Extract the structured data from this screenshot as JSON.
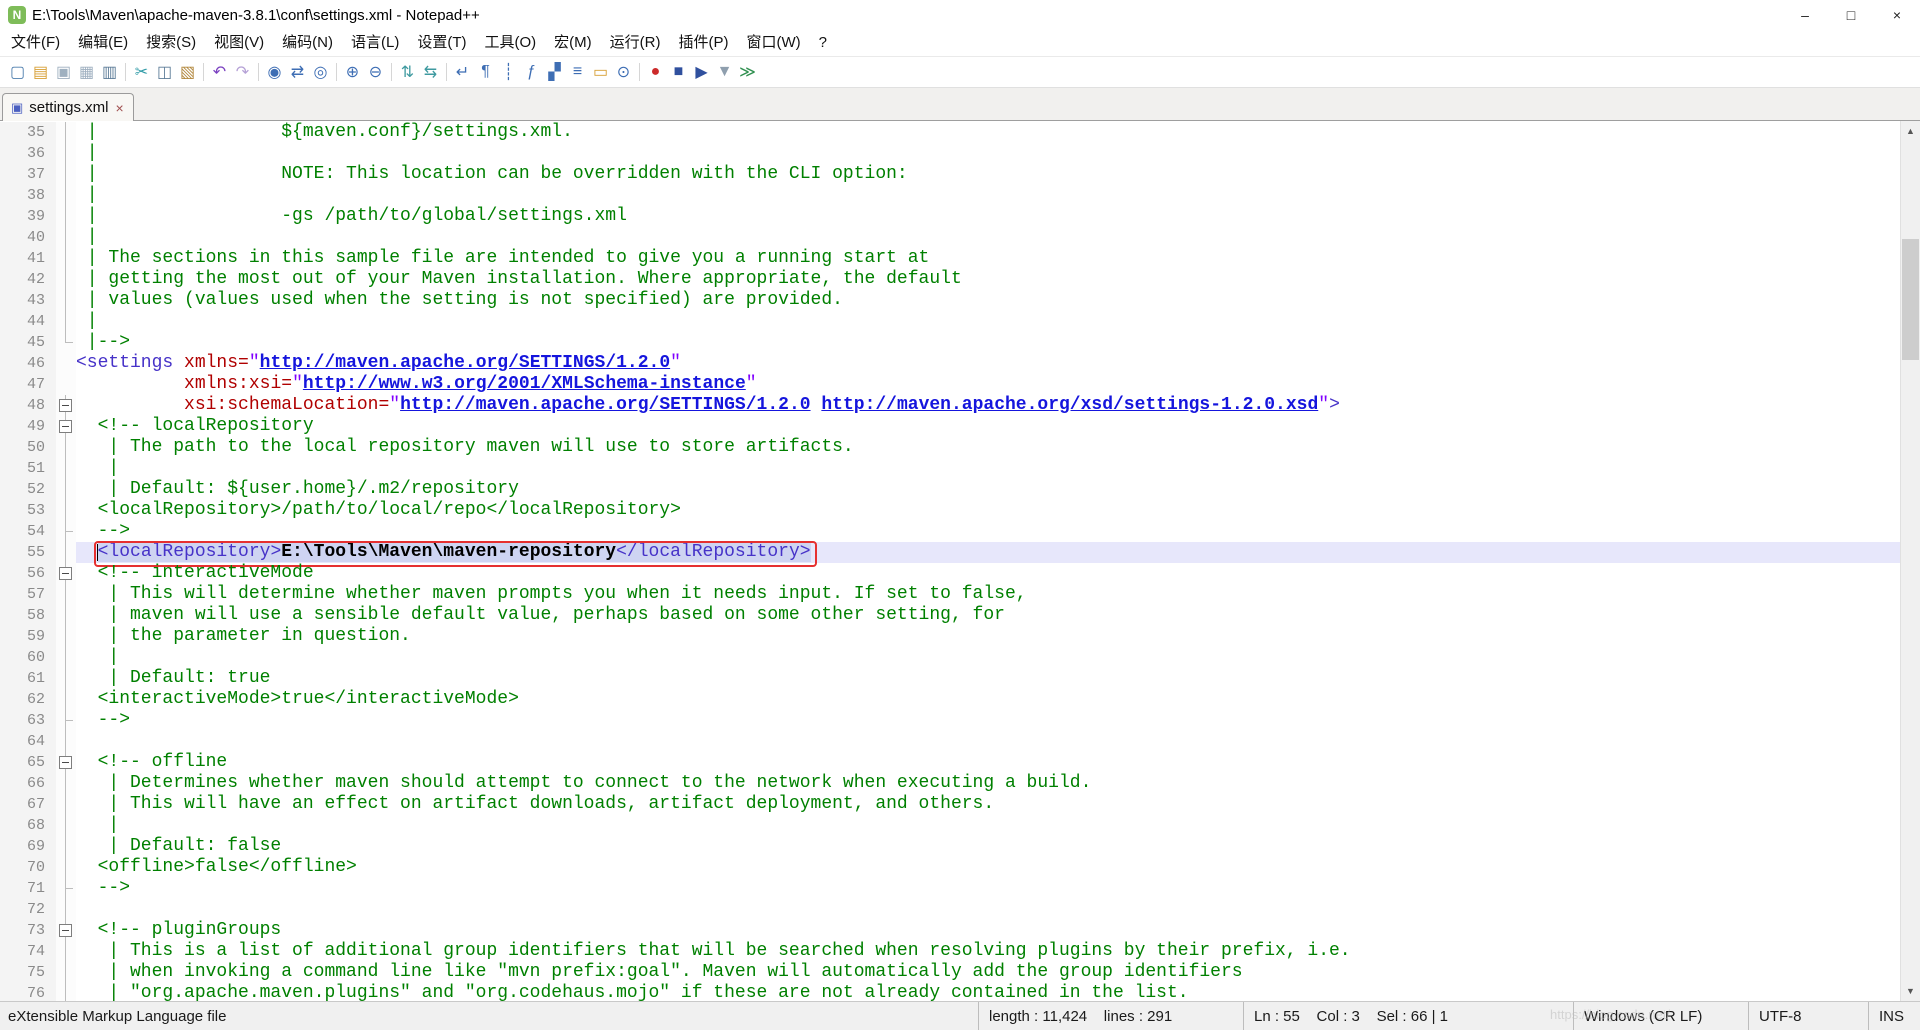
{
  "window": {
    "title": "E:\\Tools\\Maven\\apache-maven-3.8.1\\conf\\settings.xml - Notepad++",
    "app_icon_letter": "N",
    "controls": {
      "minimize": "–",
      "maximize": "□",
      "close": "×"
    }
  },
  "menu_bar": {
    "items": [
      "文件(F)",
      "编辑(E)",
      "搜索(S)",
      "视图(V)",
      "编码(N)",
      "语言(L)",
      "设置(T)",
      "工具(O)",
      "宏(M)",
      "运行(R)",
      "插件(P)",
      "窗口(W)",
      "?"
    ]
  },
  "toolbar": {
    "icons": [
      {
        "name": "new-file",
        "glyph": "▢",
        "color": "#4f7fae"
      },
      {
        "name": "open-file",
        "glyph": "▤",
        "color": "#d79f35"
      },
      {
        "name": "save-file",
        "glyph": "▣",
        "color": "#9fb0c0"
      },
      {
        "name": "save-all",
        "glyph": "▦",
        "color": "#9fb0c0"
      },
      {
        "name": "print",
        "glyph": "▥",
        "color": "#5e7d99"
      },
      {
        "sep": true
      },
      {
        "name": "cut",
        "glyph": "✂",
        "color": "#2e9aa6"
      },
      {
        "name": "copy",
        "glyph": "◫",
        "color": "#5e7d99"
      },
      {
        "name": "paste",
        "glyph": "▧",
        "color": "#b3893f"
      },
      {
        "sep": true
      },
      {
        "name": "undo",
        "glyph": "↶",
        "color": "#7a3fc0"
      },
      {
        "name": "redo",
        "glyph": "↷",
        "color": "#b5a1d6"
      },
      {
        "sep": true
      },
      {
        "name": "find",
        "glyph": "◉",
        "color": "#3e6eb4"
      },
      {
        "name": "replace",
        "glyph": "⇄",
        "color": "#3e6eb4"
      },
      {
        "name": "find-in-files",
        "glyph": "◎",
        "color": "#3e6eb4"
      },
      {
        "sep": true
      },
      {
        "name": "zoom-in",
        "glyph": "⊕",
        "color": "#3e6eb4"
      },
      {
        "name": "zoom-out",
        "glyph": "⊖",
        "color": "#3e6eb4"
      },
      {
        "sep": true
      },
      {
        "name": "sync-vertical-scroll",
        "glyph": "⇅",
        "color": "#3f9aa0"
      },
      {
        "name": "sync-horizontal-scroll",
        "glyph": "⇆",
        "color": "#3f9aa0"
      },
      {
        "sep": true
      },
      {
        "name": "word-wrap",
        "glyph": "↵",
        "color": "#3e6eb4"
      },
      {
        "name": "show-all-characters",
        "glyph": "¶",
        "color": "#3e6eb4"
      },
      {
        "name": "show-indent-guide",
        "glyph": "┊",
        "color": "#3e6eb4"
      },
      {
        "name": "function-list",
        "glyph": "ƒ",
        "color": "#3e6eb4"
      },
      {
        "name": "document-map",
        "glyph": "▞",
        "color": "#3e6eb4"
      },
      {
        "name": "document-list",
        "glyph": "≡",
        "color": "#3e6eb4"
      },
      {
        "name": "folder-as-workspace",
        "glyph": "▭",
        "color": "#d79f35"
      },
      {
        "name": "monitoring",
        "glyph": "⊙",
        "color": "#3e6eb4"
      },
      {
        "sep": true
      },
      {
        "name": "record-macro",
        "glyph": "●",
        "color": "#cc2b2b"
      },
      {
        "name": "stop-recording",
        "glyph": "■",
        "color": "#30509e"
      },
      {
        "name": "play-macro",
        "glyph": "▶",
        "color": "#30509e"
      },
      {
        "name": "save-macro",
        "glyph": "▼",
        "color": "#8f9fae"
      },
      {
        "name": "run-macro-multiple",
        "glyph": "≫",
        "color": "#2f8f4f"
      }
    ]
  },
  "tab_bar": {
    "tabs": [
      {
        "label": "settings.xml",
        "save_icon": "▣",
        "close_icon": "×",
        "active": true
      }
    ]
  },
  "editor": {
    "first_line": 35,
    "current_line": 55,
    "lines": [
      {
        "n": 35,
        "fold": "line",
        "seg": [
          [
            "c",
            " |                 ${maven.conf}/settings.xml."
          ]
        ]
      },
      {
        "n": 36,
        "fold": "line",
        "seg": [
          [
            "c",
            " |"
          ]
        ]
      },
      {
        "n": 37,
        "fold": "line",
        "seg": [
          [
            "c",
            " |                 NOTE: This location can be overridden with the CLI option:"
          ]
        ]
      },
      {
        "n": 38,
        "fold": "line",
        "seg": [
          [
            "c",
            " |"
          ]
        ]
      },
      {
        "n": 39,
        "fold": "line",
        "seg": [
          [
            "c",
            " |                 -gs /path/to/global/settings.xml"
          ]
        ]
      },
      {
        "n": 40,
        "fold": "line",
        "seg": [
          [
            "c",
            " |"
          ]
        ]
      },
      {
        "n": 41,
        "fold": "line",
        "seg": [
          [
            "c",
            " | The sections in this sample file are intended to give you a running start at"
          ]
        ]
      },
      {
        "n": 42,
        "fold": "line",
        "seg": [
          [
            "c",
            " | getting the most out of your Maven installation. Where appropriate, the default"
          ]
        ]
      },
      {
        "n": 43,
        "fold": "line",
        "seg": [
          [
            "c",
            " | values (values used when the setting is not specified) are provided."
          ]
        ]
      },
      {
        "n": 44,
        "fold": "line",
        "seg": [
          [
            "c",
            " |"
          ]
        ]
      },
      {
        "n": 45,
        "fold": "corner",
        "seg": [
          [
            "c",
            " |-->"
          ]
        ]
      },
      {
        "n": 46,
        "fold": "",
        "seg": [
          [
            "t",
            "<settings "
          ],
          [
            "a",
            "xmlns="
          ],
          [
            "v",
            "\""
          ],
          [
            "u",
            "http://maven.apache.org/SETTINGS/1.2.0"
          ],
          [
            "v",
            "\""
          ]
        ]
      },
      {
        "n": 47,
        "fold": "",
        "seg": [
          [
            "p",
            "          "
          ],
          [
            "a",
            "xmlns:xsi="
          ],
          [
            "v",
            "\""
          ],
          [
            "u",
            "http://www.w3.org/2001/XMLSchema-instance"
          ],
          [
            "v",
            "\""
          ]
        ]
      },
      {
        "n": 48,
        "fold": "box",
        "seg": [
          [
            "p",
            "          "
          ],
          [
            "a",
            "xsi:schemaLocation="
          ],
          [
            "v",
            "\""
          ],
          [
            "u",
            "http://maven.apache.org/SETTINGS/1.2.0"
          ],
          [
            "p",
            " "
          ],
          [
            "u",
            "http://maven.apache.org/xsd/settings-1.2.0.xsd"
          ],
          [
            "v",
            "\""
          ],
          [
            "t",
            ">"
          ]
        ]
      },
      {
        "n": 49,
        "fold": "box",
        "seg": [
          [
            "c",
            "  <!-- localRepository"
          ]
        ]
      },
      {
        "n": 50,
        "fold": "line",
        "seg": [
          [
            "c",
            "   | The path to the local repository maven will use to store artifacts."
          ]
        ]
      },
      {
        "n": 51,
        "fold": "line",
        "seg": [
          [
            "c",
            "   |"
          ]
        ]
      },
      {
        "n": 52,
        "fold": "line",
        "seg": [
          [
            "c",
            "   | Default: ${user.home}/.m2/repository"
          ]
        ]
      },
      {
        "n": 53,
        "fold": "line",
        "seg": [
          [
            "c",
            "  <localRepository>/path/to/local/repo</localRepository>"
          ]
        ]
      },
      {
        "n": 54,
        "fold": "end",
        "seg": [
          [
            "c",
            "  -->"
          ]
        ]
      },
      {
        "n": 55,
        "fold": "line",
        "selected_from": 1,
        "redbox": true,
        "caret": true,
        "seg": [
          [
            "p",
            "  "
          ],
          [
            "t",
            "<localRepository>"
          ],
          [
            "b",
            "E:\\Tools\\Maven\\maven-repository"
          ],
          [
            "t",
            "</localRepository>"
          ]
        ]
      },
      {
        "n": 56,
        "fold": "box",
        "seg": [
          [
            "c",
            "  <!-- interactiveMode"
          ]
        ]
      },
      {
        "n": 57,
        "fold": "line",
        "seg": [
          [
            "c",
            "   | This will determine whether maven prompts you when it needs input. If set to false,"
          ]
        ]
      },
      {
        "n": 58,
        "fold": "line",
        "seg": [
          [
            "c",
            "   | maven will use a sensible default value, perhaps based on some other setting, for"
          ]
        ]
      },
      {
        "n": 59,
        "fold": "line",
        "seg": [
          [
            "c",
            "   | the parameter in question."
          ]
        ]
      },
      {
        "n": 60,
        "fold": "line",
        "seg": [
          [
            "c",
            "   |"
          ]
        ]
      },
      {
        "n": 61,
        "fold": "line",
        "seg": [
          [
            "c",
            "   | Default: true"
          ]
        ]
      },
      {
        "n": 62,
        "fold": "line",
        "seg": [
          [
            "c",
            "  <interactiveMode>true</interactiveMode>"
          ]
        ]
      },
      {
        "n": 63,
        "fold": "end",
        "seg": [
          [
            "c",
            "  -->"
          ]
        ]
      },
      {
        "n": 64,
        "fold": "line",
        "seg": []
      },
      {
        "n": 65,
        "fold": "box",
        "seg": [
          [
            "c",
            "  <!-- offline"
          ]
        ]
      },
      {
        "n": 66,
        "fold": "line",
        "seg": [
          [
            "c",
            "   | Determines whether maven should attempt to connect to the network when executing a build."
          ]
        ]
      },
      {
        "n": 67,
        "fold": "line",
        "seg": [
          [
            "c",
            "   | This will have an effect on artifact downloads, artifact deployment, and others."
          ]
        ]
      },
      {
        "n": 68,
        "fold": "line",
        "seg": [
          [
            "c",
            "   |"
          ]
        ]
      },
      {
        "n": 69,
        "fold": "line",
        "seg": [
          [
            "c",
            "   | Default: false"
          ]
        ]
      },
      {
        "n": 70,
        "fold": "line",
        "seg": [
          [
            "c",
            "  <offline>false</offline>"
          ]
        ]
      },
      {
        "n": 71,
        "fold": "end",
        "seg": [
          [
            "c",
            "  -->"
          ]
        ]
      },
      {
        "n": 72,
        "fold": "line",
        "seg": []
      },
      {
        "n": 73,
        "fold": "box",
        "seg": [
          [
            "c",
            "  <!-- pluginGroups"
          ]
        ]
      },
      {
        "n": 74,
        "fold": "line",
        "seg": [
          [
            "c",
            "   | This is a list of additional group identifiers that will be searched when resolving plugins by their prefix, i.e."
          ]
        ]
      },
      {
        "n": 75,
        "fold": "line",
        "seg": [
          [
            "c",
            "   | when invoking a command line like \"mvn prefix:goal\". Maven will automatically add the group identifiers"
          ]
        ]
      },
      {
        "n": 76,
        "fold": "line",
        "seg": [
          [
            "c",
            "   | \"org.apache.maven.plugins\" and \"org.codehaus.mojo\" if these are not already contained in the list."
          ]
        ]
      }
    ]
  },
  "scrollbar": {
    "total_lines": 291,
    "visible_lines": 42,
    "up_glyph": "▲",
    "down_glyph": "▼"
  },
  "status_bar": {
    "doc_type": "eXtensible Markup Language file",
    "length_info": "length : 11,424    lines : 291",
    "cursor_info": "Ln : 55    Col : 3    Sel : 66 | 1",
    "eol": "Windows (CR LF)",
    "encoding": "UTF-8",
    "insert_mode": "INS",
    "watermark": "https://blog.csdn.net/"
  },
  "colors": {
    "comment": "#008000",
    "tag": "#4632c8",
    "attribute": "#b00000",
    "value": "#8000ff",
    "url_link": "#1515dd",
    "current_line_bg": "#e7e7fb",
    "annotation_box": "#e63030"
  }
}
